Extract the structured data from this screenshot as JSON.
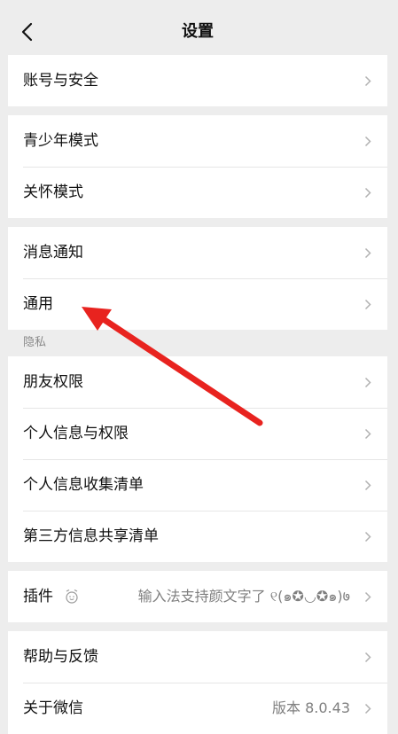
{
  "header": {
    "title": "设置"
  },
  "groups": [
    [
      "账号与安全"
    ],
    [
      "青少年模式",
      "关怀模式"
    ],
    [
      "消息通知",
      "通用"
    ]
  ],
  "privacy": {
    "section_title": "隐私",
    "items": [
      "朋友权限",
      "个人信息与权限",
      "个人信息收集清单",
      "第三方信息共享清单"
    ]
  },
  "plugin": {
    "label": "插件",
    "value": "输入法支持颜文字了 ୧(๑✪◡✪๑)७"
  },
  "about": {
    "help_label": "帮助与反馈",
    "wechat_label": "关于微信",
    "version": "版本 8.0.43"
  },
  "icons": {
    "back": "chevron-left-icon",
    "row": "chevron-right-icon",
    "plugin": "alarm-face-icon"
  },
  "colors": {
    "annotation_arrow": "#e8231f",
    "background": "#ededed"
  }
}
